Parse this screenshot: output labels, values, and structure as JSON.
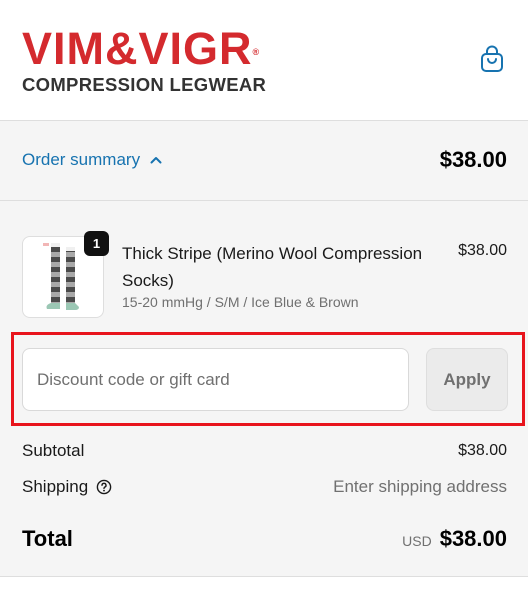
{
  "header": {
    "logo_text": "VIM&VIGR",
    "logo_reg": "®",
    "logo_tagline": "COMPRESSION LEGWEAR",
    "cart_icon": "shopping-bag-icon",
    "brand_color": "#d42a2e"
  },
  "summary": {
    "toggle_label": "Order summary",
    "toggle_icon": "chevron-up-icon",
    "total": "$38.00",
    "link_color": "#1773b0"
  },
  "line_items": [
    {
      "quantity": "1",
      "name": "Thick Stripe (Merino Wool Compression Socks)",
      "variant": "15-20 mmHg / S/M / Ice Blue & Brown",
      "price": "$38.00",
      "image_icon": "striped-socks-image"
    }
  ],
  "discount": {
    "placeholder": "Discount code or gift card",
    "value": "",
    "apply_label": "Apply",
    "highlight_color": "#e8141c"
  },
  "totals": {
    "subtotal_label": "Subtotal",
    "subtotal_value": "$38.00",
    "shipping_label": "Shipping",
    "shipping_help_icon": "question-circle-icon",
    "shipping_value": "Enter shipping address",
    "total_label": "Total",
    "currency": "USD",
    "total_value": "$38.00"
  }
}
